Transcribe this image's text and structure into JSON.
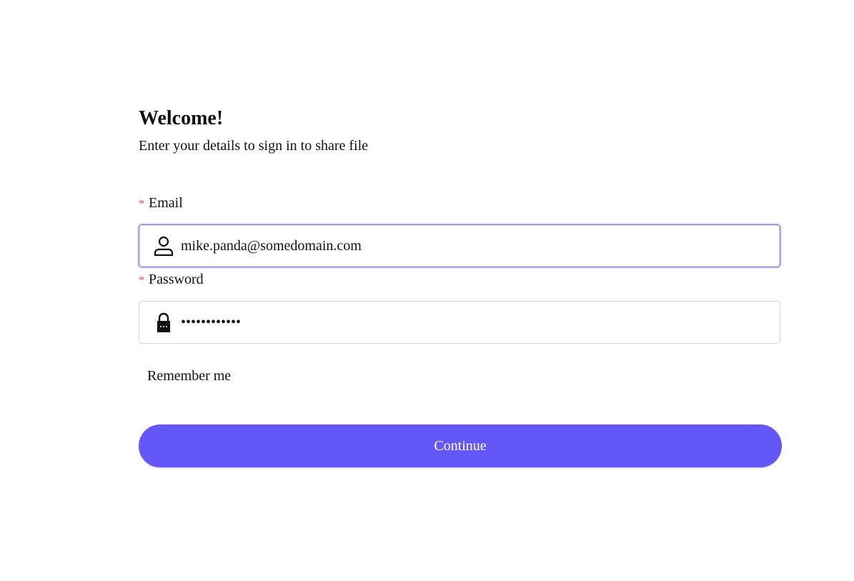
{
  "header": {
    "title": "Welcome!",
    "subtitle": "Enter your details to sign in to share file"
  },
  "form": {
    "required_mark": "*",
    "email": {
      "label": "Email",
      "value": "mike.panda@somedomain.com",
      "icon": "user-icon"
    },
    "password": {
      "label": "Password",
      "value": "••••••••••••",
      "icon": "lock-icon"
    },
    "remember_label": "Remember me",
    "submit_label": "Continue"
  },
  "colors": {
    "accent": "#6357f5",
    "required": "#e0523f"
  }
}
